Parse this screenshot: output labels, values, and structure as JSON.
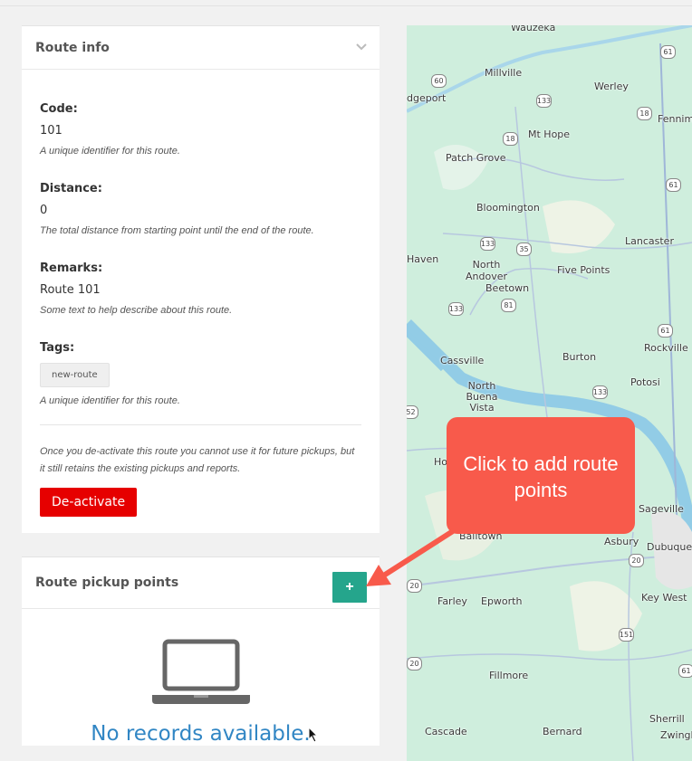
{
  "route_info": {
    "title": "Route info",
    "code_label": "Code:",
    "code_value": "101",
    "code_hint": "A unique identifier for this route.",
    "distance_label": "Distance:",
    "distance_value": "0",
    "distance_hint": "The total distance from starting point until the end of the route.",
    "remarks_label": "Remarks:",
    "remarks_value": "Route 101",
    "remarks_hint": "Some text to help describe about this route.",
    "tags_label": "Tags:",
    "tag": "new-route",
    "tags_hint": "A unique identifier for this route.",
    "deactivate_note": "Once you de-activate this route you cannot use it for future pickups, but it still retains the existing pickups and reports.",
    "deactivate_label": "De-activate"
  },
  "pickup_points": {
    "title": "Route pickup points",
    "add_label": "+",
    "empty_text": "No records available."
  },
  "callout": {
    "text": "Click to add route points"
  },
  "map": {
    "places": [
      "Wauzeka",
      "Millville",
      "dgeport",
      "Werley",
      "Fennim",
      "Mt Hope",
      "Patch Grove",
      "Bloomington",
      "Lancaster",
      "Haven",
      "North Andover",
      "Five Points",
      "Beetown",
      "Cassville",
      "Burton",
      "Rockville",
      "Potosi",
      "North Buena Vista",
      "Sageville",
      "Ho",
      "Balltown",
      "Asbury",
      "Dubuque",
      "Farley",
      "Epworth",
      "Key West",
      "Fillmore",
      "Cascade",
      "Bernard",
      "Sherrill",
      "Zwingle"
    ],
    "shields": [
      "61",
      "60",
      "133",
      "18",
      "18",
      "61",
      "133",
      "35",
      "81",
      "133",
      "61",
      "133",
      "52",
      "20",
      "20",
      "151",
      "20",
      "61",
      "18",
      "151"
    ]
  }
}
